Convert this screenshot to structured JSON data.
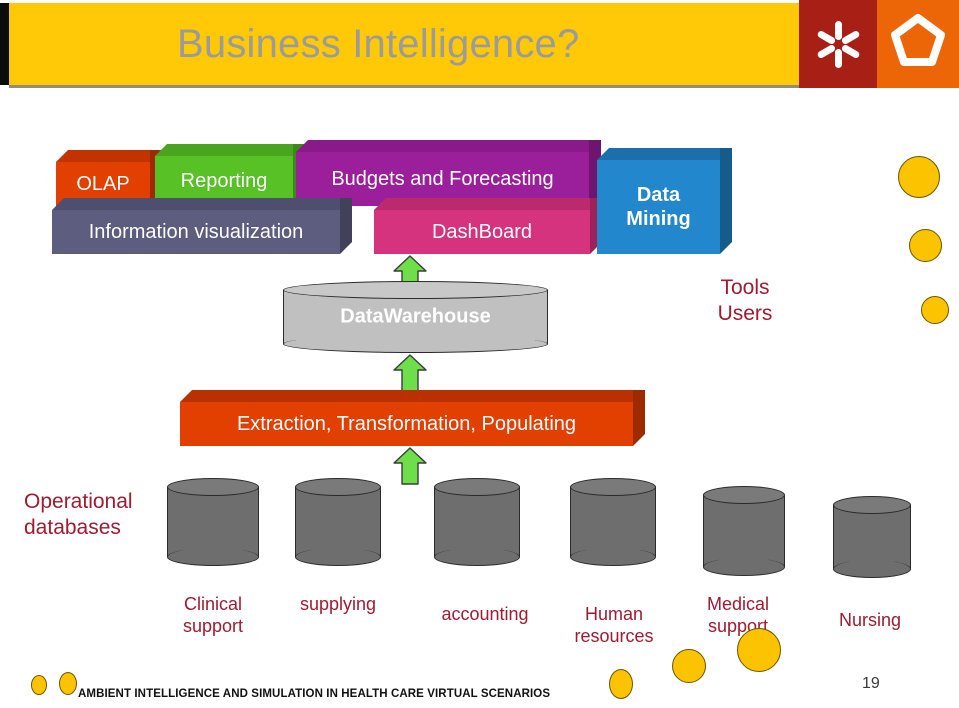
{
  "header": {
    "title": "Business Intelligence?",
    "logo_left_icon": "asterisk-burst-icon",
    "logo_right_icon": "pentagon-outline-icon",
    "gold": "#ffc907",
    "logo_left_bg": "#a81f16",
    "logo_right_bg": "#ec6608"
  },
  "diagram": {
    "tool_blocks": [
      {
        "id": "olap",
        "label": "OLAP",
        "color": "#e24000",
        "top": "#c23300",
        "side": "#9e2a00"
      },
      {
        "id": "reporting",
        "label": "Reporting",
        "color": "#57c126",
        "top": "#49a51e",
        "side": "#3d8a19"
      },
      {
        "id": "budgets",
        "label": "Budgets and Forecasting",
        "color": "#9b1f9b",
        "top": "#8a1a8a",
        "side": "#6f146f"
      },
      {
        "id": "infoviz",
        "label": "Information visualization",
        "color": "#5d5d80",
        "top": "#4e4e6e",
        "side": "#414159"
      },
      {
        "id": "dashboard",
        "label": "DashBoard",
        "color": "#d6337f",
        "top": "#bb2a6f",
        "side": "#9c225c"
      },
      {
        "id": "mining",
        "label": "Data Mining",
        "color": "#2387cd",
        "top": "#1c6fa8",
        "side": "#165c8b"
      }
    ],
    "mining_label_line1": "Data",
    "mining_label_line2": "Mining",
    "warehouse": {
      "label": "DataWarehouse",
      "color": "#c0c0c0"
    },
    "etl": {
      "label": "Extraction, Transformation, Populating",
      "color": "#e24000",
      "top": "#b93100",
      "side": "#9e2a00"
    },
    "tools_users": {
      "line1": "Tools",
      "line2": "Users",
      "color": "#9e1b32"
    },
    "operational": {
      "line1": "Operational",
      "line2": "databases",
      "color": "#9e1b32"
    },
    "source_databases": [
      {
        "label": "Clinical support",
        "line1": "Clinical",
        "line2": "support"
      },
      {
        "label": "supplying",
        "line1": "supplying",
        "line2": ""
      },
      {
        "label": "accounting",
        "line1": "accounting",
        "line2": ""
      },
      {
        "label": "Human resources",
        "line1": "Human",
        "line2": "resources"
      },
      {
        "label": "Medical support",
        "line1": "Medical",
        "line2": "support"
      },
      {
        "label": "Nursing",
        "line1": "Nursing",
        "line2": ""
      }
    ],
    "arrow_color": "#6ede4b",
    "cylinder_color": "#6e6e6e"
  },
  "footer": {
    "text": "AMBIENT INTELLIGENCE AND SIMULATION IN HEALTH CARE VIRTUAL SCENARIOS",
    "page_number": "19"
  },
  "decor": {
    "dot_fill": "#fcc400",
    "dot_stroke": "#6b5505"
  }
}
